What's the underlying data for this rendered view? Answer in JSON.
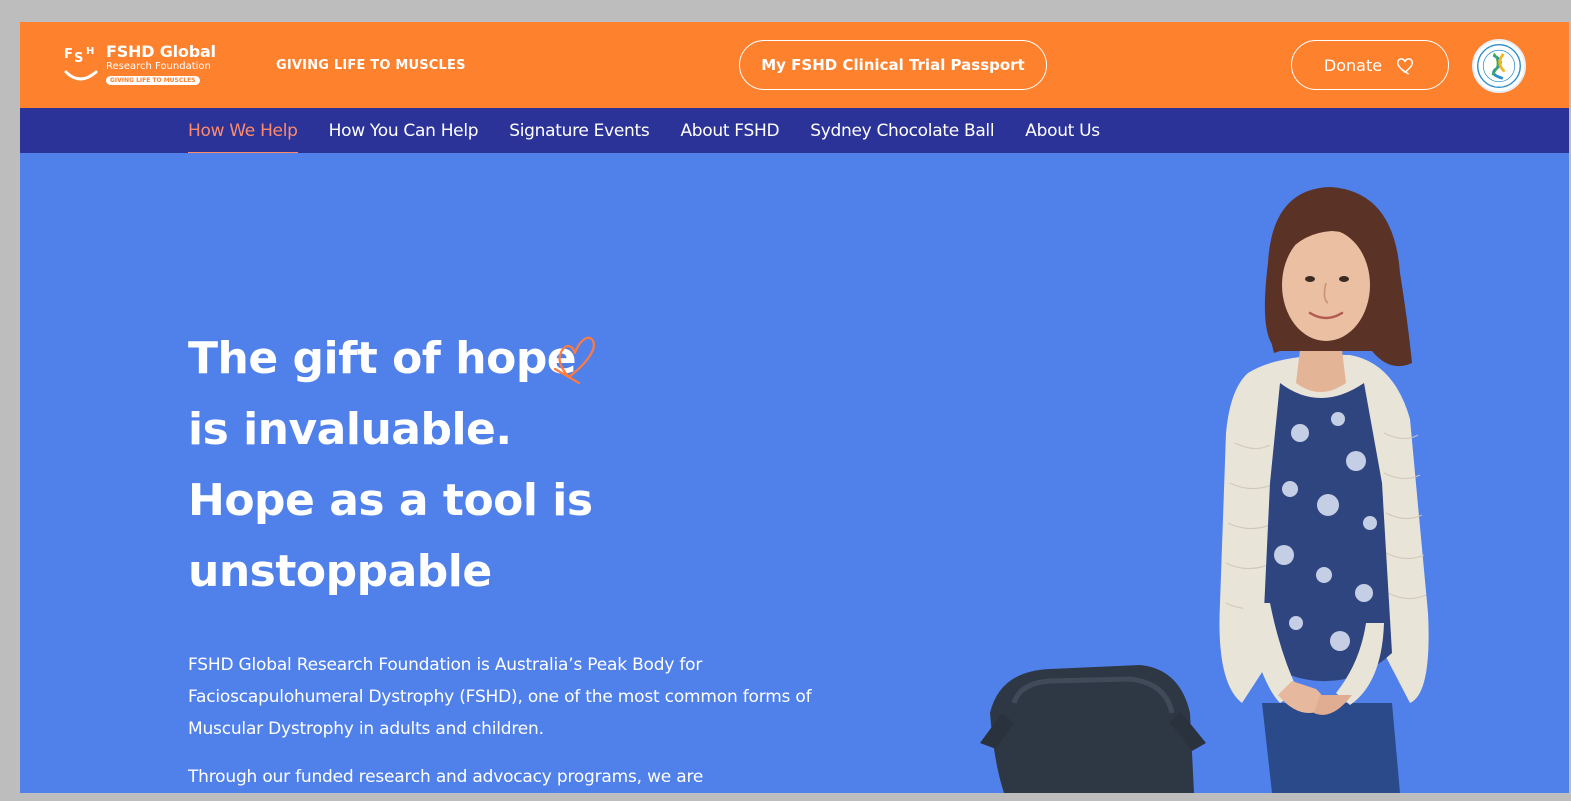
{
  "header": {
    "logo": {
      "name": "FSHD Global",
      "subname": "Research Foundation",
      "tag": "GIVING LIFE TO MUSCLES"
    },
    "tagline": "GIVING LIFE TO MUSCLES",
    "passport_label": "My FSHD Clinical Trial Passport",
    "donate_label": "Donate"
  },
  "nav": {
    "items": [
      {
        "label": "How We Help",
        "active": true
      },
      {
        "label": "How You Can Help"
      },
      {
        "label": "Signature Events"
      },
      {
        "label": "About FSHD"
      },
      {
        "label": "Sydney Chocolate Ball"
      },
      {
        "label": "About Us"
      }
    ]
  },
  "hero": {
    "heading_lines": [
      "The gift of hope",
      "is invaluable.",
      "Hope as a tool is",
      "unstoppable"
    ],
    "paragraph1": "FSHD Global Research Foundation is Australia’s Peak Body for Facioscapulohumeral Dystrophy (FSHD), one of the most common forms of Muscular Dystrophy in adults and children.",
    "paragraph2": "Through our funded research and advocacy programs, we are"
  },
  "colors": {
    "header_orange": "#fe812e",
    "nav_navy": "#2b3399",
    "hero_blue": "#5080ea",
    "active_nav": "#ff8a6a"
  },
  "icons": {
    "logo": "fshd-logo-icon",
    "donate": "heart-outline-icon",
    "badge": "registered-charity-badge-icon",
    "accent": "heart-scribble-icon"
  }
}
